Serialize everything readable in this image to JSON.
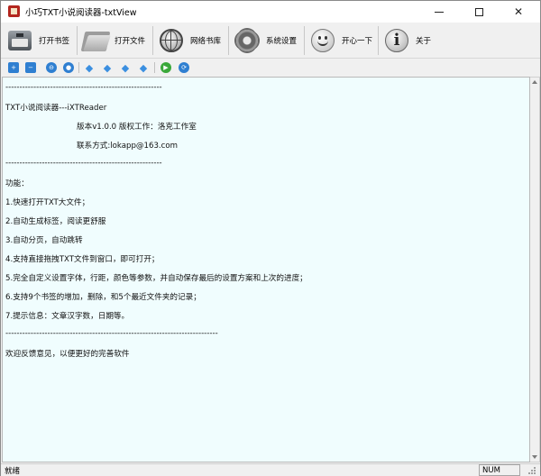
{
  "window": {
    "title": "小巧TXT小说阅读器-txtView"
  },
  "toolbar": {
    "buttons": [
      {
        "label": "打开书签",
        "icon": "bookmark-disk-icon"
      },
      {
        "label": "打开文件",
        "icon": "folder-icon"
      },
      {
        "label": "网络书库",
        "icon": "globe-icon"
      },
      {
        "label": "系统设置",
        "icon": "gear-icon"
      },
      {
        "label": "开心一下",
        "icon": "smile-icon"
      },
      {
        "label": "关于",
        "icon": "info-icon"
      }
    ]
  },
  "small_toolbar": {
    "buttons": [
      {
        "icon": "plus-icon",
        "color": "#2f7fd1"
      },
      {
        "icon": "minus-icon",
        "color": "#2f7fd1"
      },
      {
        "icon": "font-icon",
        "color": "#2f7fd1"
      },
      {
        "icon": "color-icon",
        "color": "#2f7fd1"
      },
      {
        "icon": "first-page-icon",
        "color": "#3b8fe0"
      },
      {
        "icon": "prev-page-icon",
        "color": "#3b8fe0"
      },
      {
        "icon": "next-page-icon",
        "color": "#3b8fe0"
      },
      {
        "icon": "last-page-icon",
        "color": "#3b8fe0"
      },
      {
        "icon": "play-icon",
        "color": "#3aa83a"
      },
      {
        "icon": "refresh-icon",
        "color": "#2f7fd1"
      }
    ]
  },
  "content": {
    "lines": [
      "--------------------------------------------------------",
      "TXT小说阅读器---iXTReader",
      "版本v1.0.0 版权工作：洛克工作室",
      "联系方式:lokapp@163.com",
      "--------------------------------------------------------",
      "功能：",
      "1.快速打开TXT大文件；",
      "2.自动生成标签，阅读更舒服",
      "3.自动分页，自动跳转",
      "4.支持直接拖拽TXT文件到窗口，即可打开；",
      "5.完全自定义设置字体，行距，颜色等参数，并自动保存最后的设置方案和上次的进度；",
      "6.支持9个书签的增加，删除，和5个最近文件夹的记录；",
      "7.提示信息：文章汉字数，日期等。",
      "----------------------------------------------------------------------------",
      "欢迎反馈意见，以便更好的完善软件"
    ],
    "background": "#f0fdfe"
  },
  "statusbar": {
    "status": "就绪",
    "num": "NUM"
  }
}
